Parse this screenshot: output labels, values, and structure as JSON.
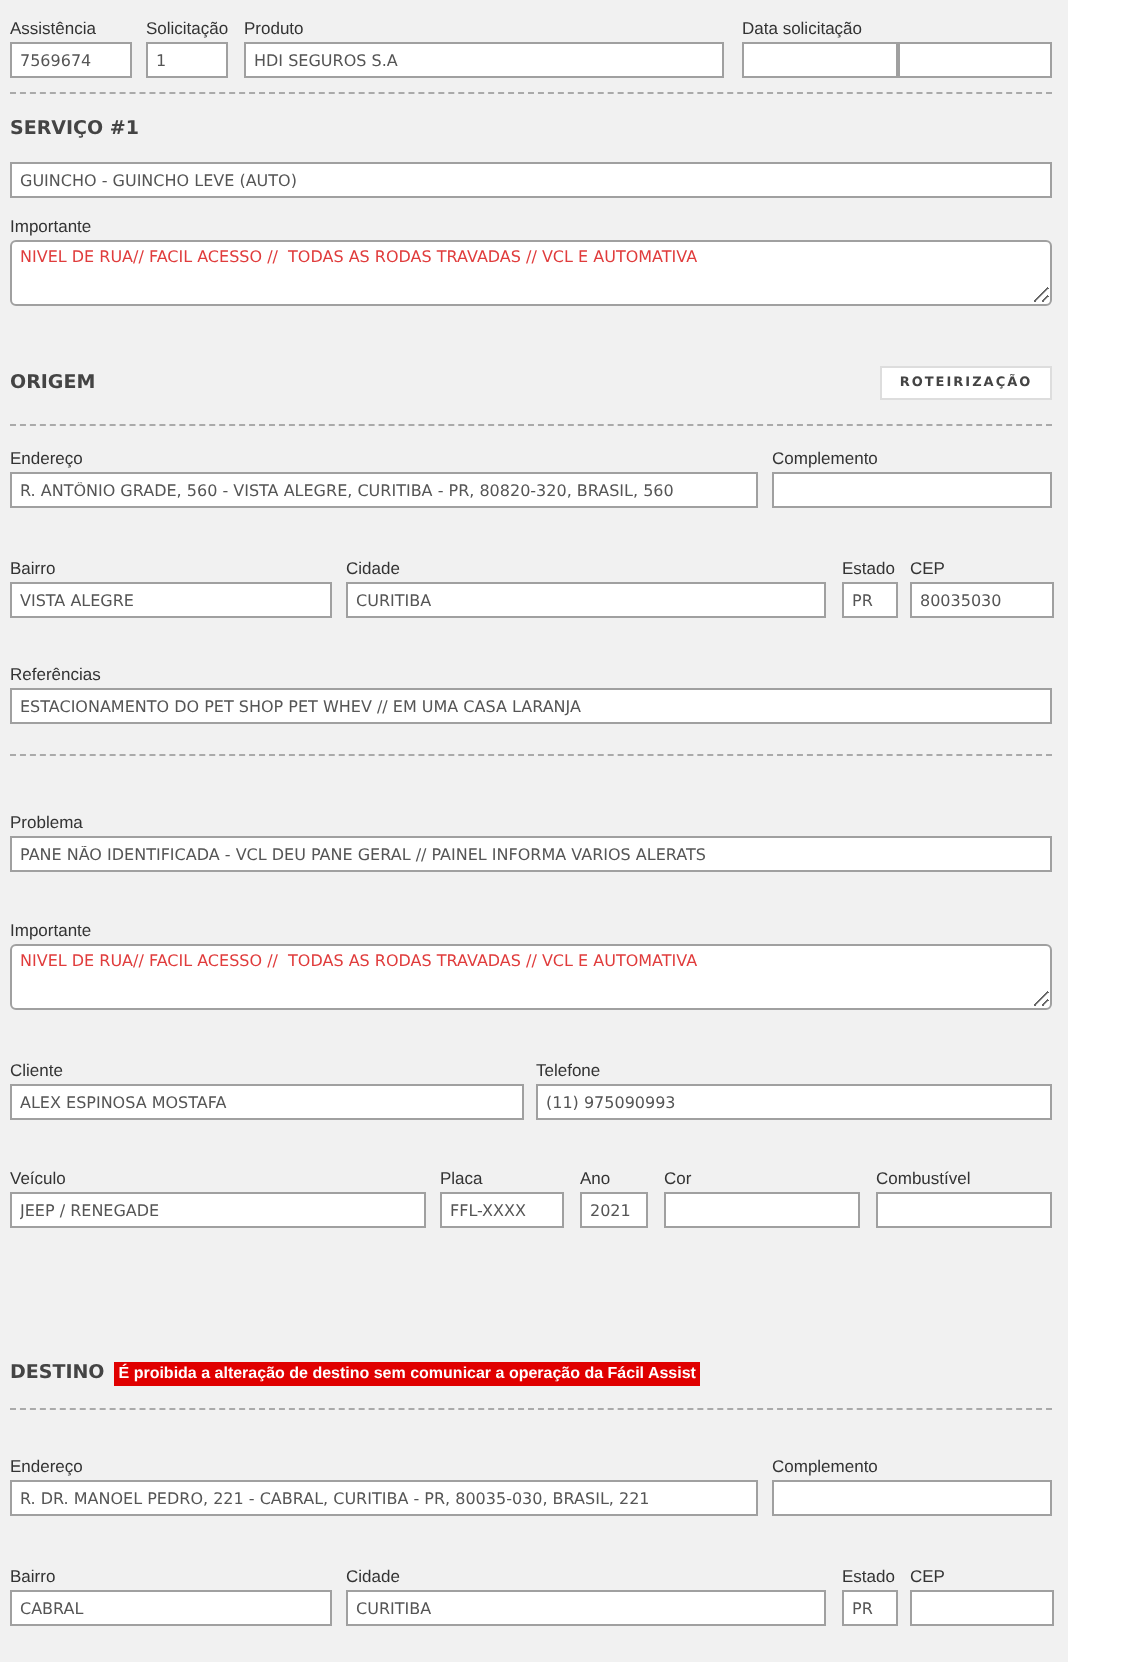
{
  "header": {
    "fields": [
      {
        "label": "Assistência",
        "value": "7569674"
      },
      {
        "label": "Solicitação",
        "value": "1"
      },
      {
        "label": "Produto",
        "value": "HDI SEGUROS S.A"
      },
      {
        "label": "Data solicitação",
        "kind": "date_time"
      }
    ]
  },
  "servico": {
    "title": "SERVIÇO #1",
    "service": "GUINCHO - GUINCHO LEVE (AUTO)",
    "important": {
      "label": "Importante",
      "value": "NIVEL DE RUA// FACIL ACESSO //  TODAS AS RODAS TRAVADAS // VCL E AUTOMATIVA"
    }
  },
  "origem": {
    "title": "ORIGEM",
    "button": "ROTEIRIZAÇÃO",
    "fields": [
      {
        "label": "Endereço",
        "value": "R. ANTÔNIO GRADE, 560 - VISTA ALEGRE, CURITIBA - PR, 80820-320, BRASIL, 560"
      },
      {
        "label": "Complemento"
      },
      {
        "label": "Bairro",
        "value": "VISTA ALEGRE"
      },
      {
        "label": "Cidade",
        "value": "CURITIBA"
      },
      {
        "label": "Estado",
        "value": "PR"
      },
      {
        "label": "CEP",
        "value": "80035030"
      },
      {
        "label": "Referências",
        "value": "ESTACIONAMENTO DO PET SHOP PET WHEV // EM UMA CASA LARANJA"
      }
    ]
  },
  "problema": {
    "fields": [
      {
        "label": "Problema",
        "value": "PANE NÃO IDENTIFICADA - VCL DEU PANE GERAL // PAINEL INFORMA VARIOS ALERATS"
      },
      {
        "label": "Importante",
        "value": "NIVEL DE RUA// FACIL ACESSO //  TODAS AS RODAS TRAVADAS // VCL E AUTOMATIVA",
        "kind": "textarea"
      },
      {
        "label": "Cliente",
        "value": "ALEX ESPINOSA MOSTAFA"
      },
      {
        "label": "Telefone",
        "value": "(11) 975090993"
      },
      {
        "label": "Veículo",
        "value": "JEEP / RENEGADE"
      },
      {
        "label": "Placa",
        "value": "FFL-XXXX"
      },
      {
        "label": "Ano",
        "value": "2021"
      },
      {
        "label": "Cor"
      },
      {
        "label": "Combustível"
      }
    ]
  },
  "destino": {
    "title": "DESTINO",
    "warning": "É proibida a alteração de destino sem comunicar a operação da Fácil Assist",
    "fields": [
      {
        "label": "Endereço",
        "value": "R. DR. MANOEL PEDRO, 221 - CABRAL, CURITIBA - PR, 80035-030, BRASIL, 221"
      },
      {
        "label": "Complemento"
      },
      {
        "label": "Bairro",
        "value": "CABRAL"
      },
      {
        "label": "Cidade",
        "value": "CURITIBA"
      },
      {
        "label": "Estado",
        "value": "PR"
      },
      {
        "label": "CEP"
      }
    ]
  }
}
